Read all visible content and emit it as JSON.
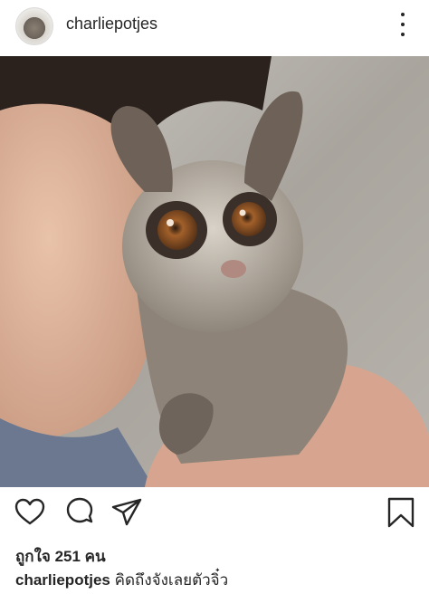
{
  "post": {
    "username": "charliepotjes",
    "likes_text": "ถูกใจ 251 คน",
    "caption_user": "charliepotjes",
    "caption_text": "คิดถึงจังเลยตัวจิ๋ว"
  },
  "icons": {
    "more": "more-vertical-icon",
    "like": "heart-icon",
    "comment": "comment-icon",
    "share": "send-icon",
    "save": "bookmark-icon"
  },
  "colors": {
    "text": "#262626",
    "background": "#ffffff",
    "divider": "#dbdbdb"
  }
}
